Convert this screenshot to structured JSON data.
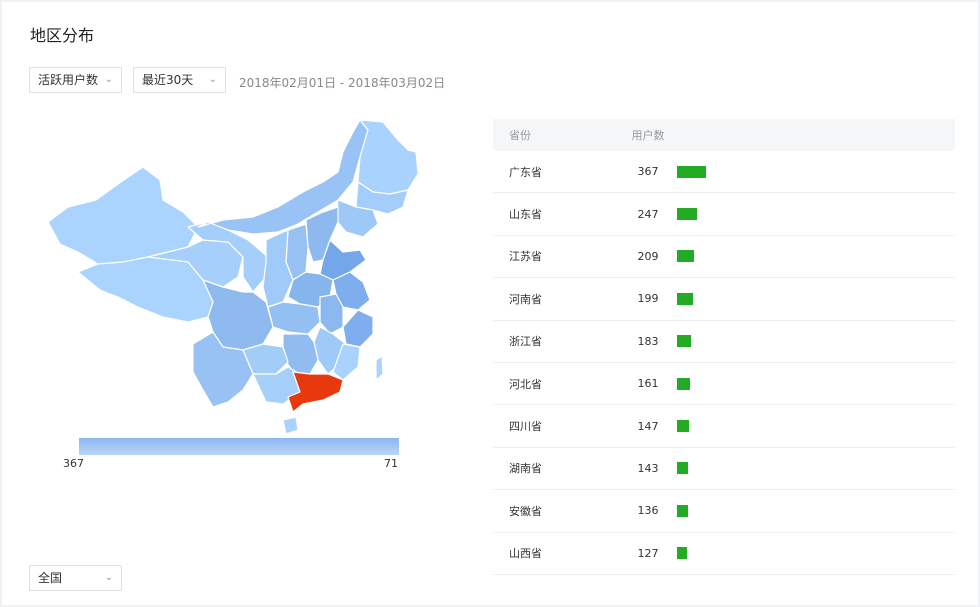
{
  "title": "地区分布",
  "filters": {
    "metric": "活跃用户数",
    "period": "最近30天",
    "date_range": "2018年02月01日 - 2018年03月02日",
    "region": "全国"
  },
  "legend": {
    "min_label": "367",
    "max_label": "71"
  },
  "colors": {
    "highlight": "#e8380d",
    "bar": "#23ab23",
    "map_light": "#a9d3fd",
    "map_dark": "#7aaef0"
  },
  "table": {
    "headers": {
      "province": "省份",
      "users": "用户数"
    },
    "rows": [
      {
        "province": "广东省",
        "users": "367"
      },
      {
        "province": "山东省",
        "users": "247"
      },
      {
        "province": "江苏省",
        "users": "209"
      },
      {
        "province": "河南省",
        "users": "199"
      },
      {
        "province": "浙江省",
        "users": "183"
      },
      {
        "province": "河北省",
        "users": "161"
      },
      {
        "province": "四川省",
        "users": "147"
      },
      {
        "province": "湖南省",
        "users": "143"
      },
      {
        "province": "安徽省",
        "users": "136"
      },
      {
        "province": "山西省",
        "users": "127"
      }
    ]
  },
  "bar_max_value": 367
}
